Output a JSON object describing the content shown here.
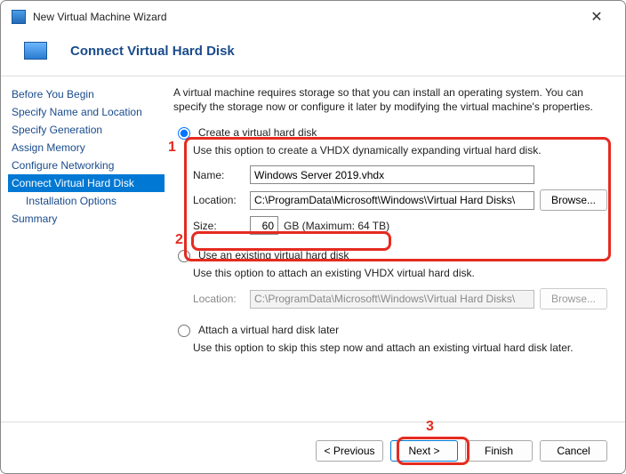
{
  "window": {
    "title": "New Virtual Machine Wizard"
  },
  "header": {
    "title": "Connect Virtual Hard Disk"
  },
  "nav": {
    "items": [
      {
        "label": "Before You Begin"
      },
      {
        "label": "Specify Name and Location"
      },
      {
        "label": "Specify Generation"
      },
      {
        "label": "Assign Memory"
      },
      {
        "label": "Configure Networking"
      },
      {
        "label": "Connect Virtual Hard Disk",
        "active": true
      },
      {
        "label": "Installation Options",
        "sub": true
      },
      {
        "label": "Summary"
      }
    ]
  },
  "content": {
    "intro": "A virtual machine requires storage so that you can install an operating system. You can specify the storage now or configure it later by modifying the virtual machine's properties.",
    "opt1": {
      "label": "Create a virtual hard disk",
      "desc": "Use this option to create a VHDX dynamically expanding virtual hard disk.",
      "name_label": "Name:",
      "name_value": "Windows Server 2019.vhdx",
      "loc_label": "Location:",
      "loc_value": "C:\\ProgramData\\Microsoft\\Windows\\Virtual Hard Disks\\",
      "browse": "Browse...",
      "size_label": "Size:",
      "size_value": "60",
      "size_suffix": "GB (Maximum: 64 TB)"
    },
    "opt2": {
      "label": "Use an existing virtual hard disk",
      "desc": "Use this option to attach an existing VHDX virtual hard disk.",
      "loc_label": "Location:",
      "loc_value": "C:\\ProgramData\\Microsoft\\Windows\\Virtual Hard Disks\\",
      "browse": "Browse..."
    },
    "opt3": {
      "label": "Attach a virtual hard disk later",
      "desc": "Use this option to skip this step now and attach an existing virtual hard disk later."
    }
  },
  "footer": {
    "previous": "< Previous",
    "next": "Next >",
    "finish": "Finish",
    "cancel": "Cancel"
  },
  "annotations": {
    "n1": "1",
    "n2": "2",
    "n3": "3"
  }
}
